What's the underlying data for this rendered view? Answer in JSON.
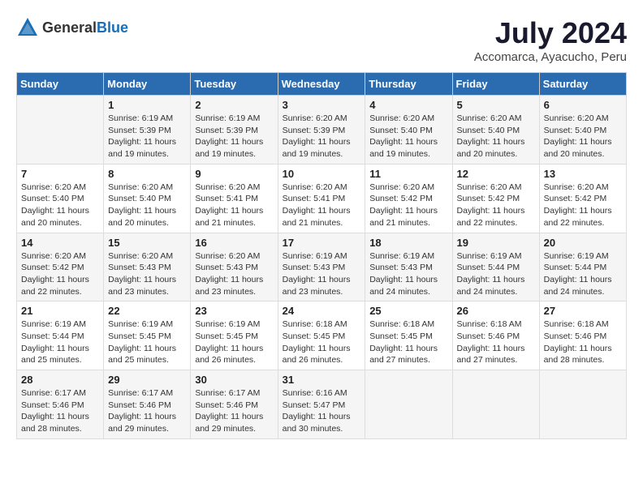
{
  "logo": {
    "general": "General",
    "blue": "Blue"
  },
  "title": "July 2024",
  "location": "Accomarca, Ayacucho, Peru",
  "days_of_week": [
    "Sunday",
    "Monday",
    "Tuesday",
    "Wednesday",
    "Thursday",
    "Friday",
    "Saturday"
  ],
  "weeks": [
    [
      {
        "day": "",
        "sunrise": "",
        "sunset": "",
        "daylight": ""
      },
      {
        "day": "1",
        "sunrise": "Sunrise: 6:19 AM",
        "sunset": "Sunset: 5:39 PM",
        "daylight": "Daylight: 11 hours and 19 minutes."
      },
      {
        "day": "2",
        "sunrise": "Sunrise: 6:19 AM",
        "sunset": "Sunset: 5:39 PM",
        "daylight": "Daylight: 11 hours and 19 minutes."
      },
      {
        "day": "3",
        "sunrise": "Sunrise: 6:20 AM",
        "sunset": "Sunset: 5:39 PM",
        "daylight": "Daylight: 11 hours and 19 minutes."
      },
      {
        "day": "4",
        "sunrise": "Sunrise: 6:20 AM",
        "sunset": "Sunset: 5:40 PM",
        "daylight": "Daylight: 11 hours and 19 minutes."
      },
      {
        "day": "5",
        "sunrise": "Sunrise: 6:20 AM",
        "sunset": "Sunset: 5:40 PM",
        "daylight": "Daylight: 11 hours and 20 minutes."
      },
      {
        "day": "6",
        "sunrise": "Sunrise: 6:20 AM",
        "sunset": "Sunset: 5:40 PM",
        "daylight": "Daylight: 11 hours and 20 minutes."
      }
    ],
    [
      {
        "day": "7",
        "sunrise": "Sunrise: 6:20 AM",
        "sunset": "Sunset: 5:40 PM",
        "daylight": "Daylight: 11 hours and 20 minutes."
      },
      {
        "day": "8",
        "sunrise": "Sunrise: 6:20 AM",
        "sunset": "Sunset: 5:40 PM",
        "daylight": "Daylight: 11 hours and 20 minutes."
      },
      {
        "day": "9",
        "sunrise": "Sunrise: 6:20 AM",
        "sunset": "Sunset: 5:41 PM",
        "daylight": "Daylight: 11 hours and 21 minutes."
      },
      {
        "day": "10",
        "sunrise": "Sunrise: 6:20 AM",
        "sunset": "Sunset: 5:41 PM",
        "daylight": "Daylight: 11 hours and 21 minutes."
      },
      {
        "day": "11",
        "sunrise": "Sunrise: 6:20 AM",
        "sunset": "Sunset: 5:42 PM",
        "daylight": "Daylight: 11 hours and 21 minutes."
      },
      {
        "day": "12",
        "sunrise": "Sunrise: 6:20 AM",
        "sunset": "Sunset: 5:42 PM",
        "daylight": "Daylight: 11 hours and 22 minutes."
      },
      {
        "day": "13",
        "sunrise": "Sunrise: 6:20 AM",
        "sunset": "Sunset: 5:42 PM",
        "daylight": "Daylight: 11 hours and 22 minutes."
      }
    ],
    [
      {
        "day": "14",
        "sunrise": "Sunrise: 6:20 AM",
        "sunset": "Sunset: 5:42 PM",
        "daylight": "Daylight: 11 hours and 22 minutes."
      },
      {
        "day": "15",
        "sunrise": "Sunrise: 6:20 AM",
        "sunset": "Sunset: 5:43 PM",
        "daylight": "Daylight: 11 hours and 23 minutes."
      },
      {
        "day": "16",
        "sunrise": "Sunrise: 6:20 AM",
        "sunset": "Sunset: 5:43 PM",
        "daylight": "Daylight: 11 hours and 23 minutes."
      },
      {
        "day": "17",
        "sunrise": "Sunrise: 6:19 AM",
        "sunset": "Sunset: 5:43 PM",
        "daylight": "Daylight: 11 hours and 23 minutes."
      },
      {
        "day": "18",
        "sunrise": "Sunrise: 6:19 AM",
        "sunset": "Sunset: 5:43 PM",
        "daylight": "Daylight: 11 hours and 24 minutes."
      },
      {
        "day": "19",
        "sunrise": "Sunrise: 6:19 AM",
        "sunset": "Sunset: 5:44 PM",
        "daylight": "Daylight: 11 hours and 24 minutes."
      },
      {
        "day": "20",
        "sunrise": "Sunrise: 6:19 AM",
        "sunset": "Sunset: 5:44 PM",
        "daylight": "Daylight: 11 hours and 24 minutes."
      }
    ],
    [
      {
        "day": "21",
        "sunrise": "Sunrise: 6:19 AM",
        "sunset": "Sunset: 5:44 PM",
        "daylight": "Daylight: 11 hours and 25 minutes."
      },
      {
        "day": "22",
        "sunrise": "Sunrise: 6:19 AM",
        "sunset": "Sunset: 5:45 PM",
        "daylight": "Daylight: 11 hours and 25 minutes."
      },
      {
        "day": "23",
        "sunrise": "Sunrise: 6:19 AM",
        "sunset": "Sunset: 5:45 PM",
        "daylight": "Daylight: 11 hours and 26 minutes."
      },
      {
        "day": "24",
        "sunrise": "Sunrise: 6:18 AM",
        "sunset": "Sunset: 5:45 PM",
        "daylight": "Daylight: 11 hours and 26 minutes."
      },
      {
        "day": "25",
        "sunrise": "Sunrise: 6:18 AM",
        "sunset": "Sunset: 5:45 PM",
        "daylight": "Daylight: 11 hours and 27 minutes."
      },
      {
        "day": "26",
        "sunrise": "Sunrise: 6:18 AM",
        "sunset": "Sunset: 5:46 PM",
        "daylight": "Daylight: 11 hours and 27 minutes."
      },
      {
        "day": "27",
        "sunrise": "Sunrise: 6:18 AM",
        "sunset": "Sunset: 5:46 PM",
        "daylight": "Daylight: 11 hours and 28 minutes."
      }
    ],
    [
      {
        "day": "28",
        "sunrise": "Sunrise: 6:17 AM",
        "sunset": "Sunset: 5:46 PM",
        "daylight": "Daylight: 11 hours and 28 minutes."
      },
      {
        "day": "29",
        "sunrise": "Sunrise: 6:17 AM",
        "sunset": "Sunset: 5:46 PM",
        "daylight": "Daylight: 11 hours and 29 minutes."
      },
      {
        "day": "30",
        "sunrise": "Sunrise: 6:17 AM",
        "sunset": "Sunset: 5:46 PM",
        "daylight": "Daylight: 11 hours and 29 minutes."
      },
      {
        "day": "31",
        "sunrise": "Sunrise: 6:16 AM",
        "sunset": "Sunset: 5:47 PM",
        "daylight": "Daylight: 11 hours and 30 minutes."
      },
      {
        "day": "",
        "sunrise": "",
        "sunset": "",
        "daylight": ""
      },
      {
        "day": "",
        "sunrise": "",
        "sunset": "",
        "daylight": ""
      },
      {
        "day": "",
        "sunrise": "",
        "sunset": "",
        "daylight": ""
      }
    ]
  ]
}
